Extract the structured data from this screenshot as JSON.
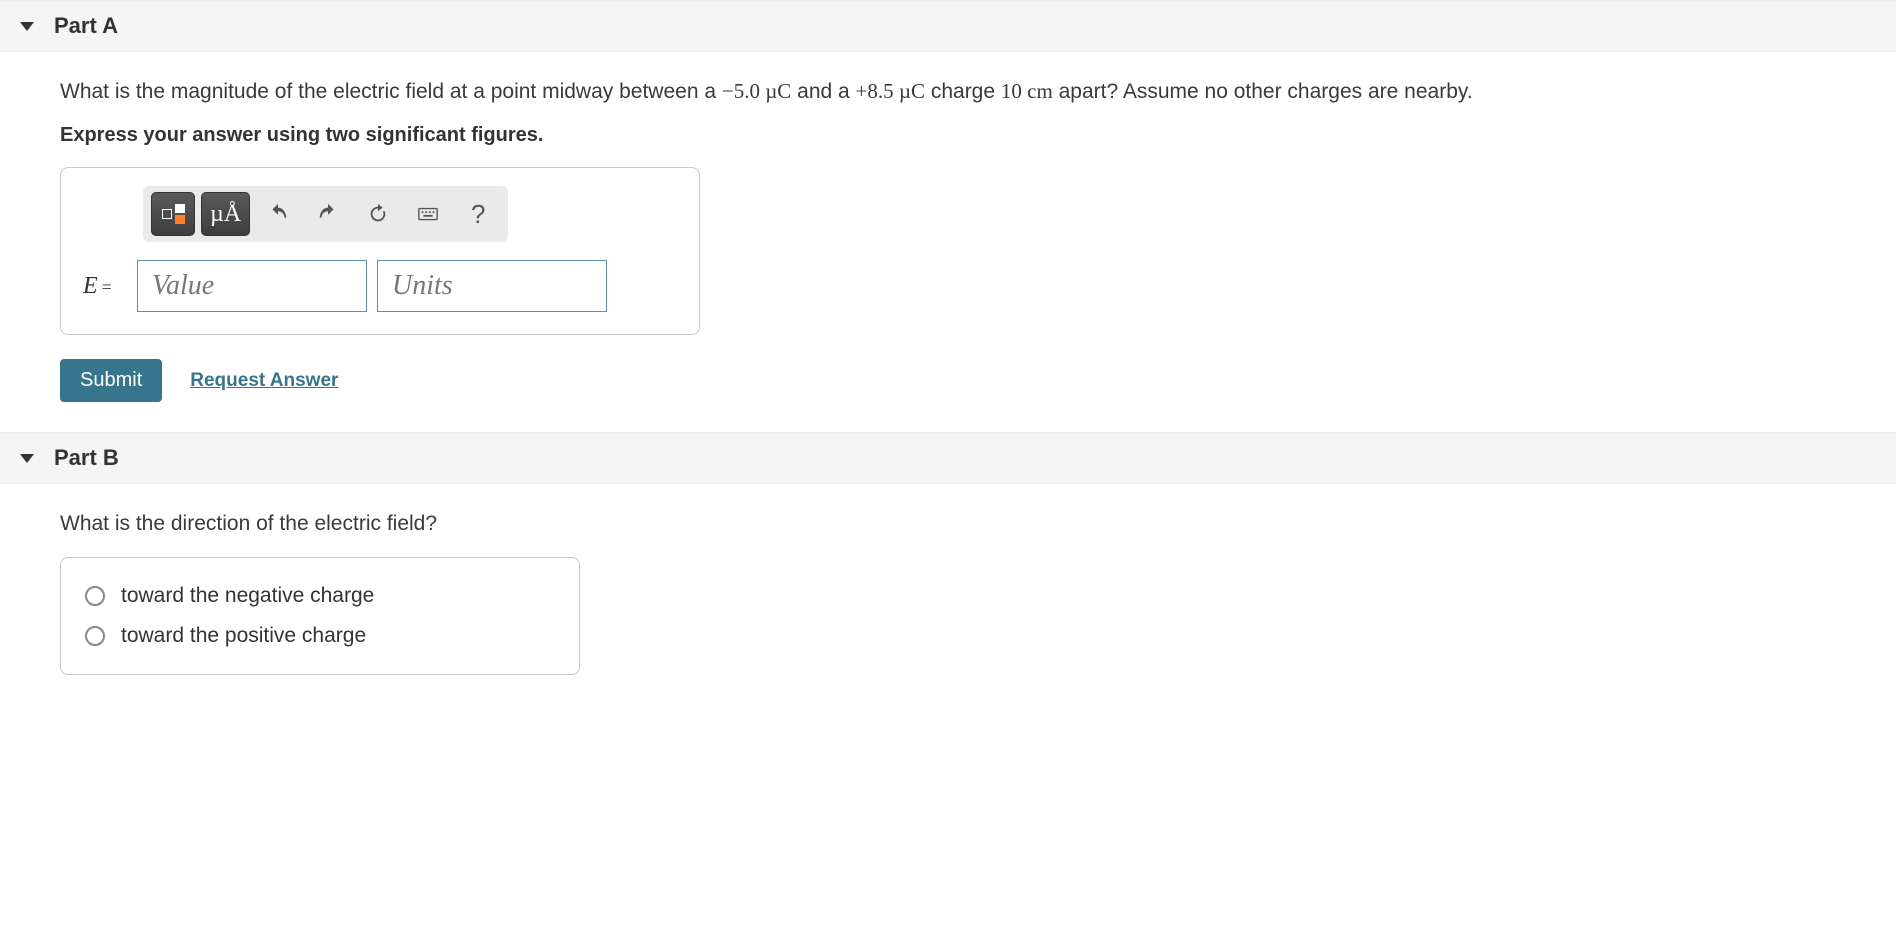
{
  "partA": {
    "title": "Part A",
    "question_pre": "What is the magnitude of the electric field at a point midway between a ",
    "q1_val": "−5.0 µC",
    "q_mid1": " and a ",
    "q2_val": "+8.5 µC",
    "q_mid2": " charge ",
    "dist": "10 cm",
    "q_post": " apart? Assume no other charges are nearby.",
    "instruction": "Express your answer using two significant figures.",
    "toolbar": {
      "mu_a": "µÅ",
      "help": "?"
    },
    "answer": {
      "label_var": "E",
      "label_eq": "=",
      "value_placeholder": "Value",
      "units_placeholder": "Units"
    },
    "submit": "Submit",
    "request": "Request Answer"
  },
  "partB": {
    "title": "Part B",
    "question": "What is the direction of the electric field?",
    "options": [
      "toward the negative charge",
      "toward the positive charge"
    ]
  }
}
